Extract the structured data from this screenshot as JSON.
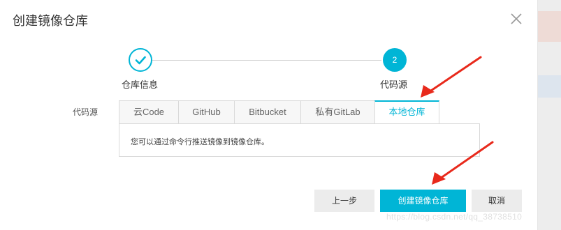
{
  "dialog": {
    "title": "创建镜像仓库",
    "close_icon": "close-icon"
  },
  "steps": [
    {
      "label": "仓库信息",
      "state": "done",
      "icon": "check-icon"
    },
    {
      "label": "代码源",
      "number": "2",
      "state": "active"
    }
  ],
  "form": {
    "source_label": "代码源",
    "tabs": [
      "云Code",
      "GitHub",
      "Bitbucket",
      "私有GitLab",
      "本地仓库"
    ],
    "active_tab_index": 4,
    "panel_text": "您可以通过命令行推送镜像到镜像仓库。"
  },
  "buttons": {
    "prev": "上一步",
    "create": "创建镜像仓库",
    "cancel": "取消"
  },
  "watermark": "https://blog.csdn.net/qq_38738510",
  "colors": {
    "accent": "#00b5d6",
    "annotation_arrow": "#e8291b",
    "button_gray": "#ececec"
  }
}
